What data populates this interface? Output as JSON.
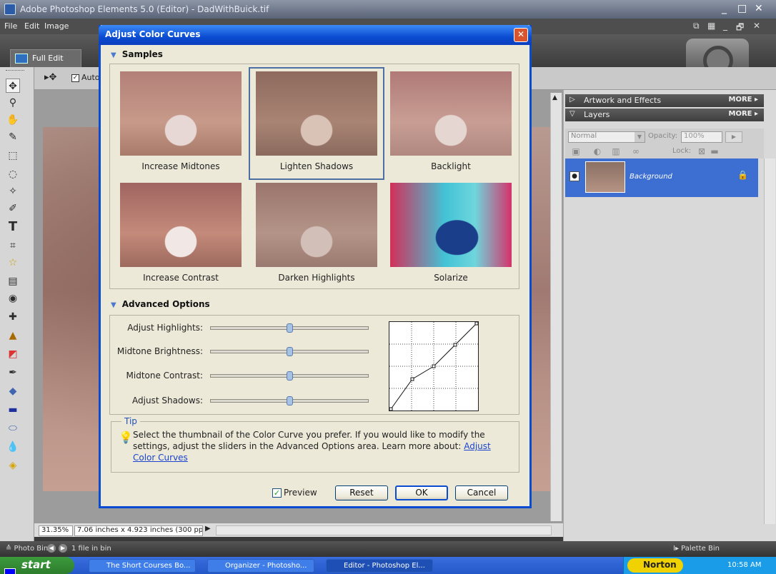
{
  "window": {
    "title": "Adobe Photoshop Elements 5.0 (Editor) - DadWithBuick.tif",
    "controls": [
      "_",
      "□",
      "✕"
    ]
  },
  "menubar": {
    "items": [
      "File",
      "Edit",
      "Image"
    ],
    "right_controls": [
      "⧉",
      "▦",
      "_",
      "🗗",
      "✕"
    ]
  },
  "modebar": {
    "full_edit": "Full Edit"
  },
  "options_bar": {
    "auto_label": "Auto"
  },
  "status": {
    "zoom": "31.35%",
    "dimensions": "7.06 inches x 4.923 inches (300 ppi)"
  },
  "palette_bin": {
    "artwork_header": "Artwork and Effects",
    "layers_header": "Layers",
    "more_label": "MORE ▸",
    "blend_mode": "Normal",
    "opacity_label": "Opacity:",
    "opacity_value": "100%",
    "lock_label": "Lock:",
    "layer_name": "Background"
  },
  "photo_bin": {
    "label": "≙ Photo Bin",
    "count": "1 file in bin",
    "palette_bin_label": "I▸ Palette Bin"
  },
  "taskbar": {
    "start": "start",
    "tasks": [
      "The Short Courses Bo...",
      "Organizer - Photosho...",
      "Editor - Photoshop El..."
    ],
    "norton": "Norton",
    "clock": "10:58 AM"
  },
  "dialog": {
    "title": "Adjust Color Curves",
    "close": "✕",
    "samples_header": "Samples",
    "samples": [
      {
        "label": "Increase Midtones",
        "selected": false
      },
      {
        "label": "Lighten Shadows",
        "selected": true
      },
      {
        "label": "Backlight",
        "selected": false
      },
      {
        "label": "Increase Contrast",
        "selected": false
      },
      {
        "label": "Darken Highlights",
        "selected": false
      },
      {
        "label": "Solarize",
        "selected": false
      }
    ],
    "advanced_header": "Advanced Options",
    "sliders": [
      {
        "label": "Adjust Highlights:",
        "value": 0.5
      },
      {
        "label": "Midtone Brightness:",
        "value": 0.5
      },
      {
        "label": "Midtone Contrast:",
        "value": 0.5
      },
      {
        "label": "Adjust Shadows:",
        "value": 0.5
      }
    ],
    "curve_points": [
      [
        0,
        0
      ],
      [
        0.25,
        0.35
      ],
      [
        0.5,
        0.5
      ],
      [
        0.75,
        0.75
      ],
      [
        1,
        1
      ]
    ],
    "tip_legend": "Tip",
    "tip_text": "Select the thumbnail of the Color Curve you prefer. If you would like to modify the settings, adjust the sliders in the Advanced Options area. Learn more about:",
    "tip_link": "Adjust Color Curves",
    "preview_label": "Preview",
    "preview_checked": true,
    "reset": "Reset",
    "ok": "OK",
    "cancel": "Cancel"
  }
}
